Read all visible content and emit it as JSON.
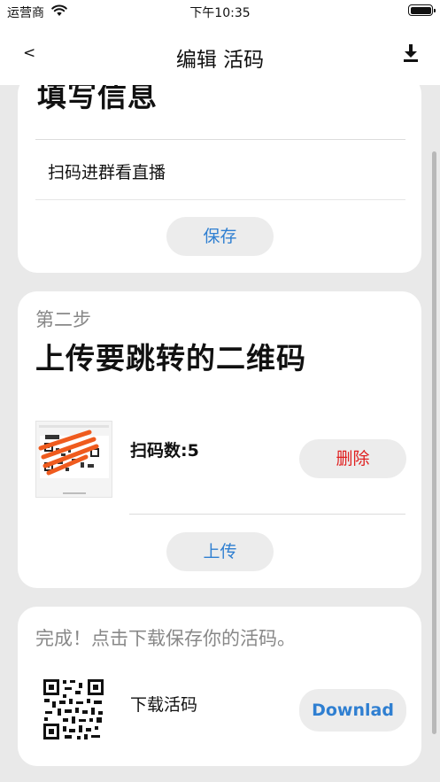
{
  "status_bar": {
    "carrier": "运营商",
    "time": "下午10:35"
  },
  "nav": {
    "back_label": "<",
    "title": "编辑 活码",
    "download_icon": "download-icon"
  },
  "step1": {
    "heading": "填写信息",
    "field_text": "扫码进群看直播",
    "save_label": "保存"
  },
  "step2": {
    "step_label": "第二步",
    "heading": "上传要跳转的二维码",
    "scan_count": "扫码数:5",
    "delete_label": "删除",
    "upload_label": "上传"
  },
  "step3": {
    "done_text": "完成！点击下载保存你的活码。",
    "download_label": "下载活码",
    "download_button": "Downlad"
  },
  "colors": {
    "accent_blue": "#2f7fd1",
    "delete_red": "#e02020",
    "background": "#e9e9e9",
    "pill": "#ececec"
  }
}
